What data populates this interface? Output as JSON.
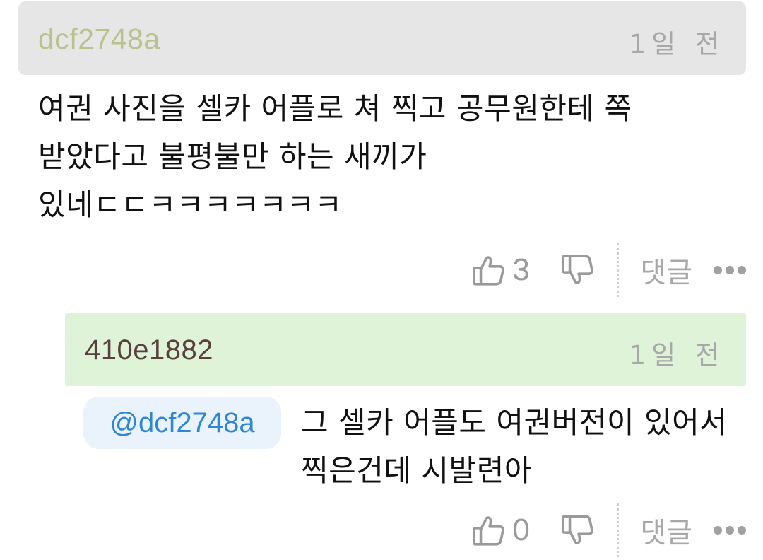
{
  "comments": [
    {
      "author": "dcf2748a",
      "time": "1일 전",
      "body": "여권 사진을 셀카 어플로 쳐 찍고 공무원한테 쪽 받았다고 불평불만 하는 새끼가 있네ㄷㄷㅋㅋㅋㅋㅋㅋㅋ",
      "likes": "3",
      "reply_label": "댓글"
    },
    {
      "author": "410e1882",
      "time": "1일 전",
      "mention": "@dcf2748a",
      "body": "그 셀카 어플도 여권버전이 있어서 찍은건데 시발련아",
      "likes": "0",
      "reply_label": "댓글"
    }
  ],
  "colors": {
    "header_bg_primary": "#e6e6e6",
    "header_bg_reply": "#dff3d9",
    "author_primary": "#b8c38c",
    "author_reply": "#5a3f3c",
    "mention_text": "#2f86d6",
    "mention_bg": "#eaf2fc",
    "muted": "#a8a8a8"
  },
  "icons": {
    "like": "thumbs-up-icon",
    "dislike": "thumbs-down-icon",
    "more": "more-dots-icon"
  }
}
